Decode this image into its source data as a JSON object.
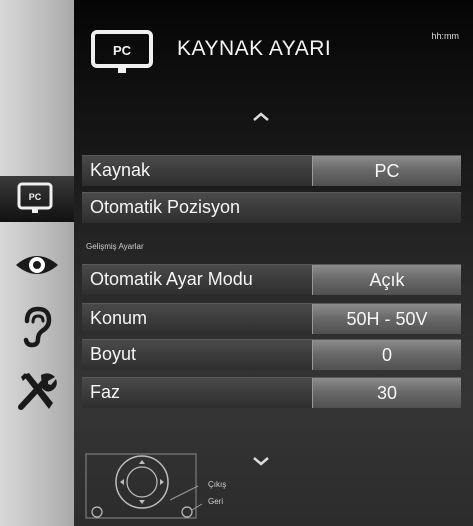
{
  "header": {
    "title": "KAYNAK AYARI",
    "clock": "hh:mm",
    "icon_label": "PC"
  },
  "menu": {
    "rows": [
      {
        "label": "Kaynak",
        "value": "PC"
      },
      {
        "label": "Otomatik Pozisyon"
      },
      {
        "label": "Otomatik Ayar Modu",
        "value": "Açık"
      },
      {
        "label": "Konum",
        "value": "50H - 50V"
      },
      {
        "label": "Boyut",
        "value": "0"
      },
      {
        "label": "Faz",
        "value": "30"
      }
    ],
    "section_label": "Gelişmiş Ayarlar"
  },
  "sidebar": {
    "items": [
      {
        "icon": "pc-source-icon",
        "label": "PC",
        "active": true
      },
      {
        "icon": "eye-icon"
      },
      {
        "icon": "ear-icon"
      },
      {
        "icon": "tools-icon"
      }
    ]
  },
  "footer": {
    "legend_exit": "Çıkış",
    "legend_back": "Geri"
  },
  "colors": {
    "panel_bg": "#1c1c1c",
    "value_box": "#707070",
    "text": "#f5f5f5"
  }
}
